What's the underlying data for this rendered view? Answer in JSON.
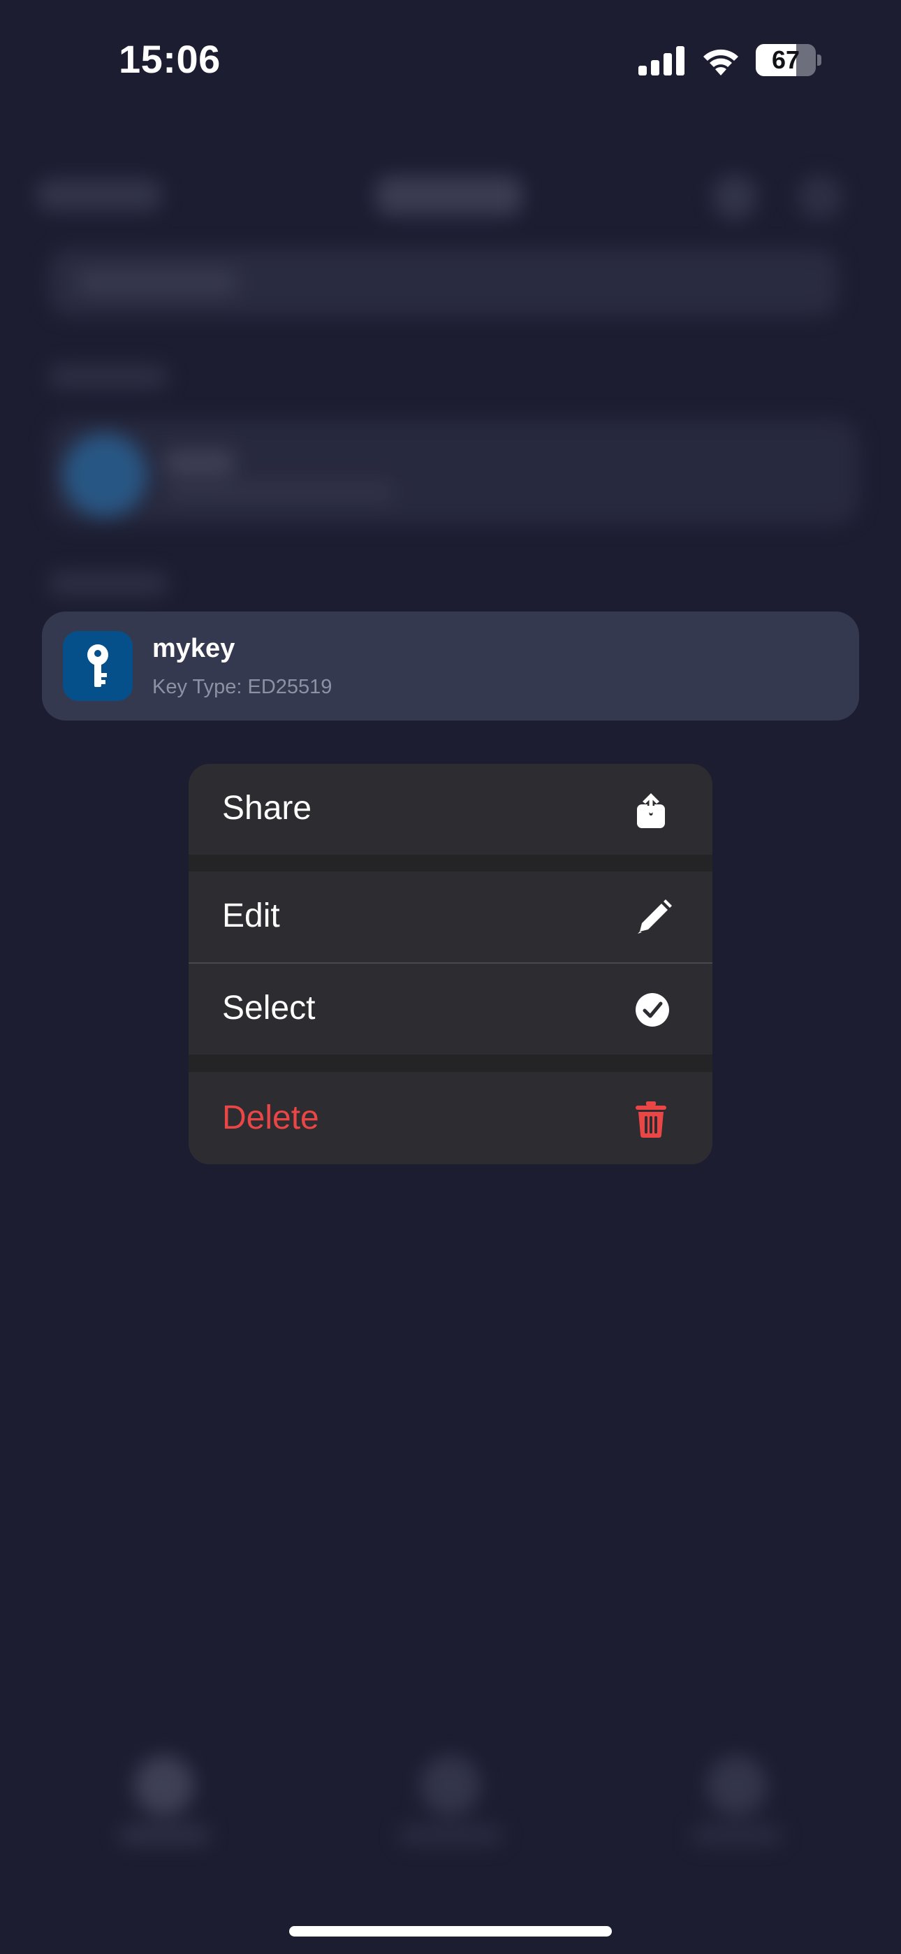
{
  "status_bar": {
    "time": "15:06",
    "battery_level": "67",
    "battery_fraction": 0.67
  },
  "key_item": {
    "name": "mykey",
    "type_label": "Key Type: ED25519",
    "icon": "key-icon",
    "icon_bg_color": "#05508b"
  },
  "context_menu": {
    "items": [
      {
        "label": "Share",
        "icon": "share-icon"
      },
      {
        "label": "Edit",
        "icon": "pencil-icon"
      },
      {
        "label": "Select",
        "icon": "checkmark-circle-icon"
      },
      {
        "label": "Delete",
        "icon": "trash-icon",
        "color": "#ea4646"
      }
    ]
  },
  "colors": {
    "background": "#1c1d31",
    "menu_background": "#2c2c31",
    "destructive": "#ea4646",
    "accent": "#05508b"
  }
}
